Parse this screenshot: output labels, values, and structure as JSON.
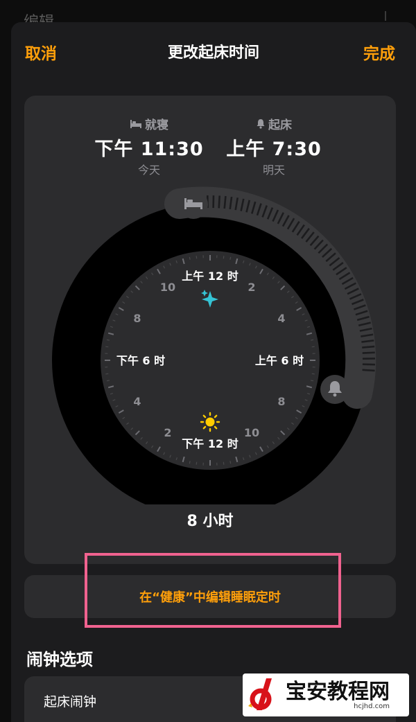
{
  "behind": {
    "title": "编辑"
  },
  "nav": {
    "cancel": "取消",
    "title": "更改起床时间",
    "done": "完成"
  },
  "schedule": {
    "bedtime": {
      "label": "就寝",
      "time": "下午 11:30",
      "day": "今天"
    },
    "wakeup": {
      "label": "起床",
      "time": "上午 7:30",
      "day": "明天"
    },
    "duration": "8 小时"
  },
  "clock": {
    "top": "上午 12 时",
    "bottom": "下午 12 时",
    "left": "下午 6 时",
    "right": "上午 6 时",
    "num_2_top": "2",
    "num_4_right": "4",
    "num_8_right": "8",
    "num_10_bottom": "10",
    "num_2_bottom": "2",
    "num_4_left": "4",
    "num_8_left": "8",
    "num_10_top": "10"
  },
  "health_link": "在“健康”中编辑睡眠定时",
  "alarm_section": {
    "header": "闹钟选项",
    "row_label": "起床闹钟"
  },
  "watermark": {
    "name": "宝安教程网",
    "url": "hcjhd.com"
  },
  "colors": {
    "accent": "#ff9f0a",
    "highlight": "#f0628f",
    "sparkle": "#35c3d4",
    "sun": "#ffcc00"
  }
}
